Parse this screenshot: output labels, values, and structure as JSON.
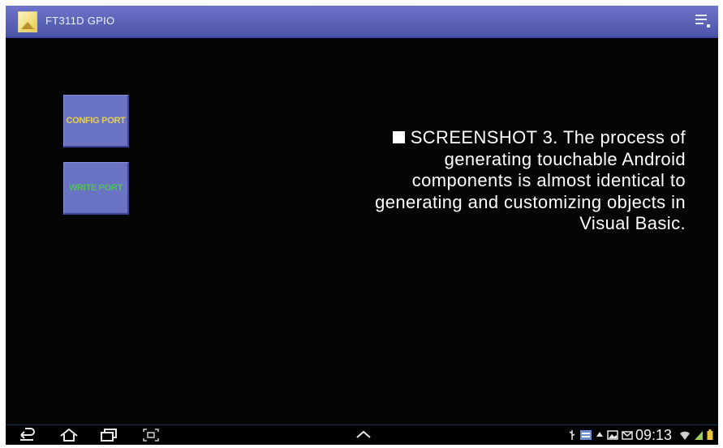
{
  "app": {
    "title": "FT311D GPIO",
    "icon": "app-launcher-icon",
    "actionbar_color": "#5a62b8"
  },
  "buttons": {
    "config_port": "CONFIG PORT",
    "write_port": "WRITE PORT",
    "config_color": "#e6d24a",
    "write_color": "#52c25a",
    "background": "#6a72c4"
  },
  "caption": {
    "lead": "SCREENSHOT 3.",
    "text": "The process of generating touchable Android components is almost identical to generating and customizing objects in Visual Basic."
  },
  "system_bar": {
    "nav_icons": [
      "back-icon",
      "home-icon",
      "recent-apps-icon",
      "screenshot-icon",
      "up-chevron-icon"
    ],
    "status_icons": [
      "usb-icon",
      "notification-icon",
      "upload-icon",
      "gallery-icon",
      "email-icon",
      "wifi-icon",
      "signal-icon",
      "battery-icon"
    ],
    "time": "09:13"
  }
}
